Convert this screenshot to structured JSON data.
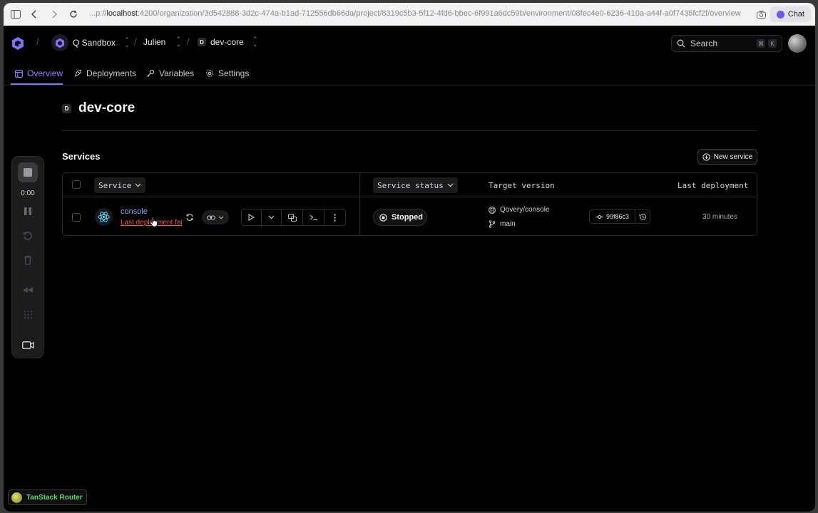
{
  "browser": {
    "url_prefix": "...p://",
    "url_host": "localhost",
    "url_rest": ":4200/organization/3d542888-3d2c-474a-b1ad-712556db66da/project/8319c5b3-5f12-4fd6-bbec-6f991a6dc59b/environment/08fec4e0-6236-410a-a44f-a0f7435fcf2f/overview",
    "chat_label": "Chat"
  },
  "topbar": {
    "org": "Q Sandbox",
    "project": "Julien",
    "env_badge": "D",
    "env": "dev-core",
    "search_label": "Search",
    "kbd_mod": "⌘",
    "kbd_key": "K"
  },
  "tabs": [
    {
      "label": "Overview"
    },
    {
      "label": "Deployments"
    },
    {
      "label": "Variables"
    },
    {
      "label": "Settings"
    }
  ],
  "page": {
    "env_badge": "D",
    "title": "dev-core",
    "services_title": "Services",
    "new_service_label": "New service"
  },
  "table": {
    "col_service": "Service",
    "col_status": "Service status",
    "col_target": "Target version",
    "col_last": "Last deployment",
    "rows": [
      {
        "name": "console",
        "subtitle": "Last deployment failed",
        "status": "Stopped",
        "repo": "Qovery/console",
        "branch": "main",
        "commit": "99f86c3",
        "last_deployment": "30 minutes"
      }
    ]
  },
  "recorder": {
    "time": "0:00"
  },
  "devtools": {
    "label": "TanStack Router"
  },
  "colors": {
    "accent": "#7c72ff",
    "error": "#ef5a4f",
    "link": "#86a8ff",
    "tanstack": "#66d46b"
  }
}
